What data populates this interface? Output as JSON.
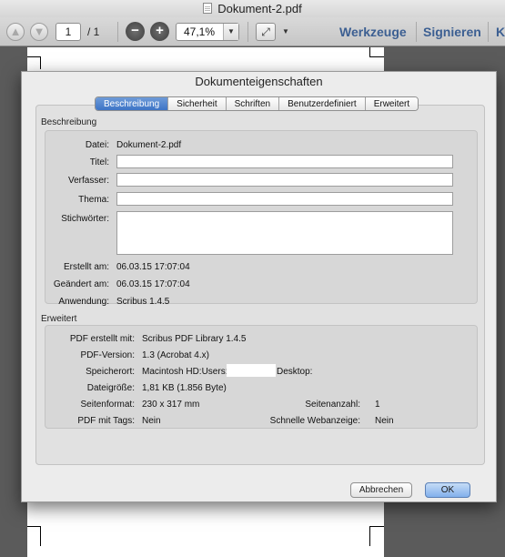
{
  "window": {
    "title": "Dokument-2.pdf",
    "icon": "pdf-document-icon"
  },
  "toolbar": {
    "page_current": "1",
    "page_total": "/ 1",
    "zoom_value": "47,1%",
    "tools_label": "Werkzeuge",
    "sign_label": "Signieren",
    "overflow_label": "K",
    "icons": [
      "arrow-up-icon",
      "arrow-down-icon",
      "zoom-out-icon",
      "zoom-in-icon",
      "expand-icon",
      "chevron-down-icon"
    ]
  },
  "dialog": {
    "title": "Dokumenteigenschaften",
    "tabs": [
      {
        "label": "Beschreibung",
        "active": true
      },
      {
        "label": "Sicherheit",
        "active": false
      },
      {
        "label": "Schriften",
        "active": false
      },
      {
        "label": "Benutzerdefiniert",
        "active": false
      },
      {
        "label": "Erweitert",
        "active": false
      }
    ],
    "description": {
      "section_title": "Beschreibung",
      "file_label": "Datei:",
      "file_value": "Dokument-2.pdf",
      "title_label": "Titel:",
      "title_value": "",
      "author_label": "Verfasser:",
      "author_value": "",
      "subject_label": "Thema:",
      "subject_value": "",
      "keywords_label": "Stichwörter:",
      "keywords_value": "",
      "created_label": "Erstellt am:",
      "created_value": "06.03.15 17:07:04",
      "modified_label": "Geändert am:",
      "modified_value": "06.03.15 17:07:04",
      "application_label": "Anwendung:",
      "application_value": "Scribus 1.4.5"
    },
    "advanced": {
      "section_title": "Erweitert",
      "producer_label": "PDF erstellt mit:",
      "producer_value": "Scribus PDF Library 1.4.5",
      "version_label": "PDF-Version:",
      "version_value": "1.3 (Acrobat 4.x)",
      "location_label": "Speicherort:",
      "location_prefix": "Macintosh HD:Users:",
      "location_suffix": "Desktop:",
      "size_label": "Dateigröße:",
      "size_value": "1,81 KB (1.856 Byte)",
      "page_format_label": "Seitenformat:",
      "page_format_value": "230 x 317 mm",
      "page_count_label": "Seitenanzahl:",
      "page_count_value": "1",
      "tagged_label": "PDF mit Tags:",
      "tagged_value": "Nein",
      "fast_web_label": "Schnelle Webanzeige:",
      "fast_web_value": "Nein"
    },
    "buttons": {
      "cancel": "Abbrechen",
      "ok": "OK"
    }
  }
}
